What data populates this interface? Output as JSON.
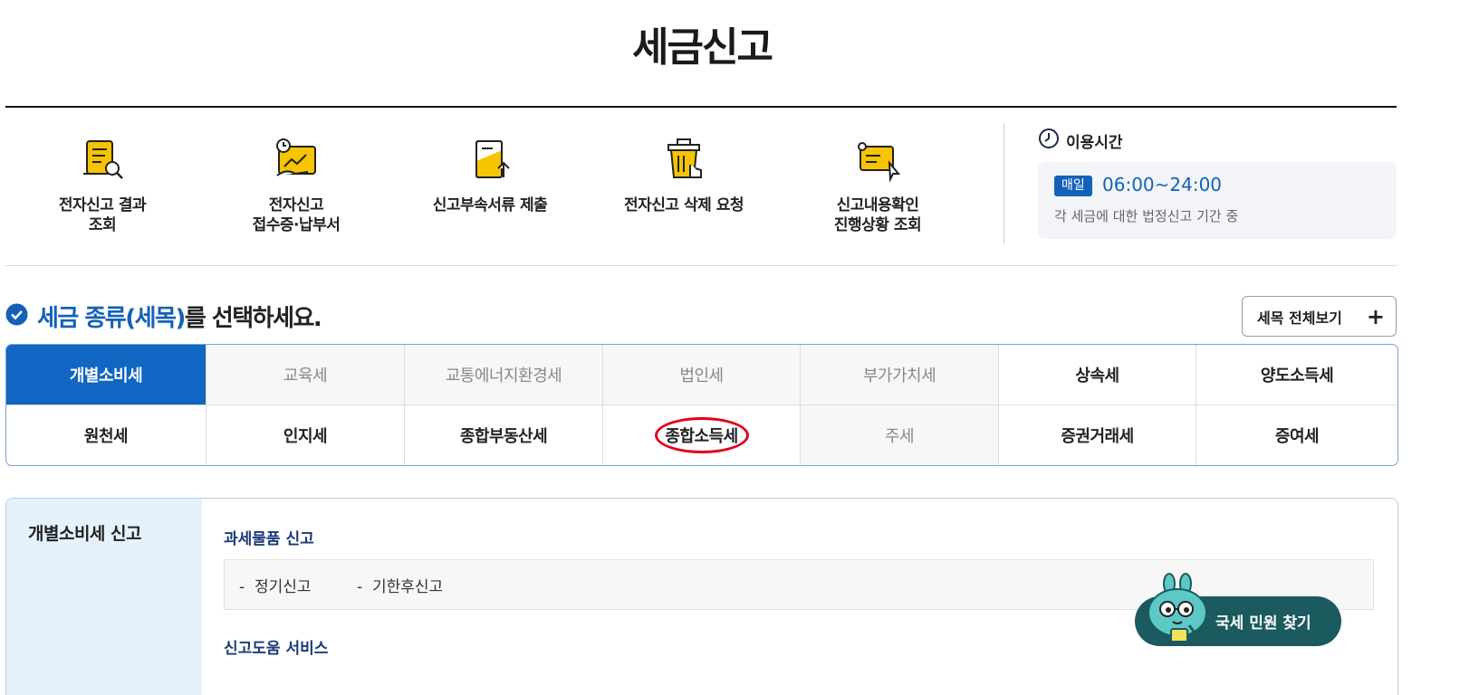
{
  "page": {
    "title": "세금신고"
  },
  "quick_menu": [
    {
      "icon": "document-search-icon",
      "label_lines": [
        "전자신고 결과",
        "조회"
      ]
    },
    {
      "icon": "receipt-payment-icon",
      "label_lines": [
        "전자신고",
        "접수증·납부서"
      ]
    },
    {
      "icon": "document-upload-icon",
      "label_lines": [
        "신고부속서류 제출"
      ]
    },
    {
      "icon": "trash-delete-icon",
      "label_lines": [
        "전자신고 삭제 요청"
      ]
    },
    {
      "icon": "monitor-check-icon",
      "label_lines": [
        "신고내용확인",
        "진행상황 조회"
      ]
    }
  ],
  "usage_time": {
    "title": "이용시간",
    "badge": "매일",
    "hours": "06:00~24:00",
    "note": "각 세금에 대한 법정신고 기간 중"
  },
  "tax_select": {
    "heading_highlight": "세금 종류(세목)",
    "heading_rest": "를 선택하세요.",
    "view_all_label": "세목 전체보기",
    "view_all_icon": "plus-icon",
    "rows": [
      [
        {
          "label": "개별소비세",
          "state": "active"
        },
        {
          "label": "교육세",
          "state": "disabled"
        },
        {
          "label": "교통에너지환경세",
          "state": "disabled"
        },
        {
          "label": "법인세",
          "state": "disabled"
        },
        {
          "label": "부가가치세",
          "state": "disabled"
        },
        {
          "label": "상속세",
          "state": "normal"
        },
        {
          "label": "양도소득세",
          "state": "normal"
        }
      ],
      [
        {
          "label": "원천세",
          "state": "normal"
        },
        {
          "label": "인지세",
          "state": "normal"
        },
        {
          "label": "종합부동산세",
          "state": "normal"
        },
        {
          "label": "종합소득세",
          "state": "normal",
          "circled": true
        },
        {
          "label": "주세",
          "state": "disabled"
        },
        {
          "label": "증권거래세",
          "state": "normal"
        },
        {
          "label": "증여세",
          "state": "normal"
        }
      ]
    ]
  },
  "detail": {
    "title": "개별소비세 신고",
    "section1_title": "과세물품 신고",
    "section1_options": [
      "정기신고",
      "기한후신고"
    ],
    "section2_title": "신고도움 서비스"
  },
  "faq_button": {
    "label": "국세 민원 찾기"
  },
  "colors": {
    "accent": "#1461b8",
    "active_tab": "#1066c2",
    "mark": "#e0001b",
    "fab": "#1b5a5f",
    "icon_yellow": "#f6c400"
  }
}
